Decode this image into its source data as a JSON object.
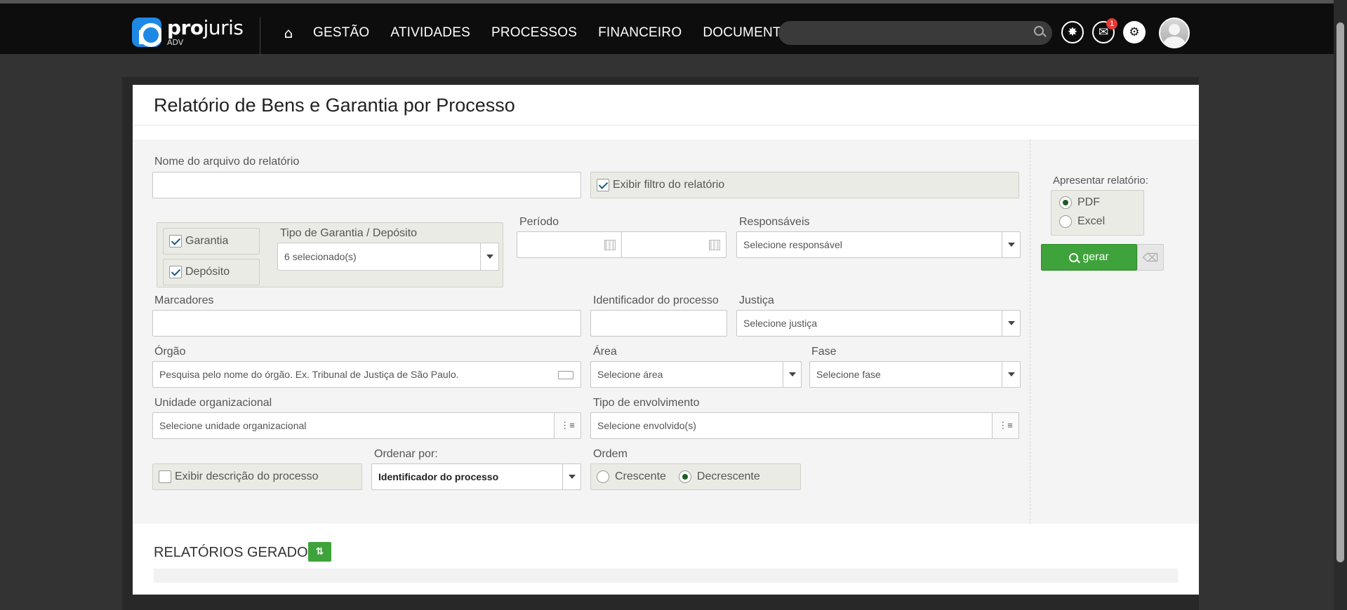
{
  "brand": {
    "name_bold": "pro",
    "name_light": "juris",
    "sub": "ADV",
    "accent": "#1e88e5"
  },
  "nav": {
    "home_icon": "home-icon",
    "items": [
      "GESTÃO",
      "ATIVIDADES",
      "PROCESSOS",
      "FINANCEIRO",
      "DOCUMENTOS"
    ]
  },
  "search": {
    "placeholder": ""
  },
  "notifications": {
    "count": "1"
  },
  "page": {
    "title": "Relatório de Bens e Garantia por Processo"
  },
  "form": {
    "filename_label": "Nome do arquivo do relatório",
    "filename_value": "",
    "show_filter_label": "Exibir filtro do relatório",
    "garantia_label": "Garantia",
    "deposito_label": "Depósito",
    "tipo_label": "Tipo de Garantia / Depósito",
    "tipo_value": "6 selecionado(s)",
    "periodo_label": "Período",
    "responsaveis_label": "Responsáveis",
    "responsaveis_placeholder": "Selecione responsável",
    "marcadores_label": "Marcadores",
    "identificador_label": "Identificador do processo",
    "justica_label": "Justiça",
    "justica_placeholder": "Selecione justiça",
    "orgao_label": "Órgão",
    "orgao_placeholder": "Pesquisa pelo nome do órgão. Ex. Tribunal de Justiça de São Paulo.",
    "area_label": "Área",
    "area_placeholder": "Selecione área",
    "fase_label": "Fase",
    "fase_placeholder": "Selecione fase",
    "unidade_label": "Unidade organizacional",
    "unidade_placeholder": "Selecione unidade organizacional",
    "envolvimento_label": "Tipo de envolvimento",
    "envolvimento_placeholder": "Selecione envolvido(s)",
    "exibir_desc_label": "Exibir descrição do processo",
    "ordenar_label": "Ordenar por:",
    "ordenar_value": "Identificador do processo",
    "ordem_label": "Ordem",
    "ordem_crescente": "Crescente",
    "ordem_decrescente": "Decrescente"
  },
  "side": {
    "apresentar_label": "Apresentar relatório:",
    "pdf": "PDF",
    "excel": "Excel",
    "gerar": "gerar"
  },
  "generated": {
    "title": "RELATÓRIOS GERADOS"
  },
  "colors": {
    "green": "#3ea33a",
    "topbar": "#0d0d0d"
  }
}
